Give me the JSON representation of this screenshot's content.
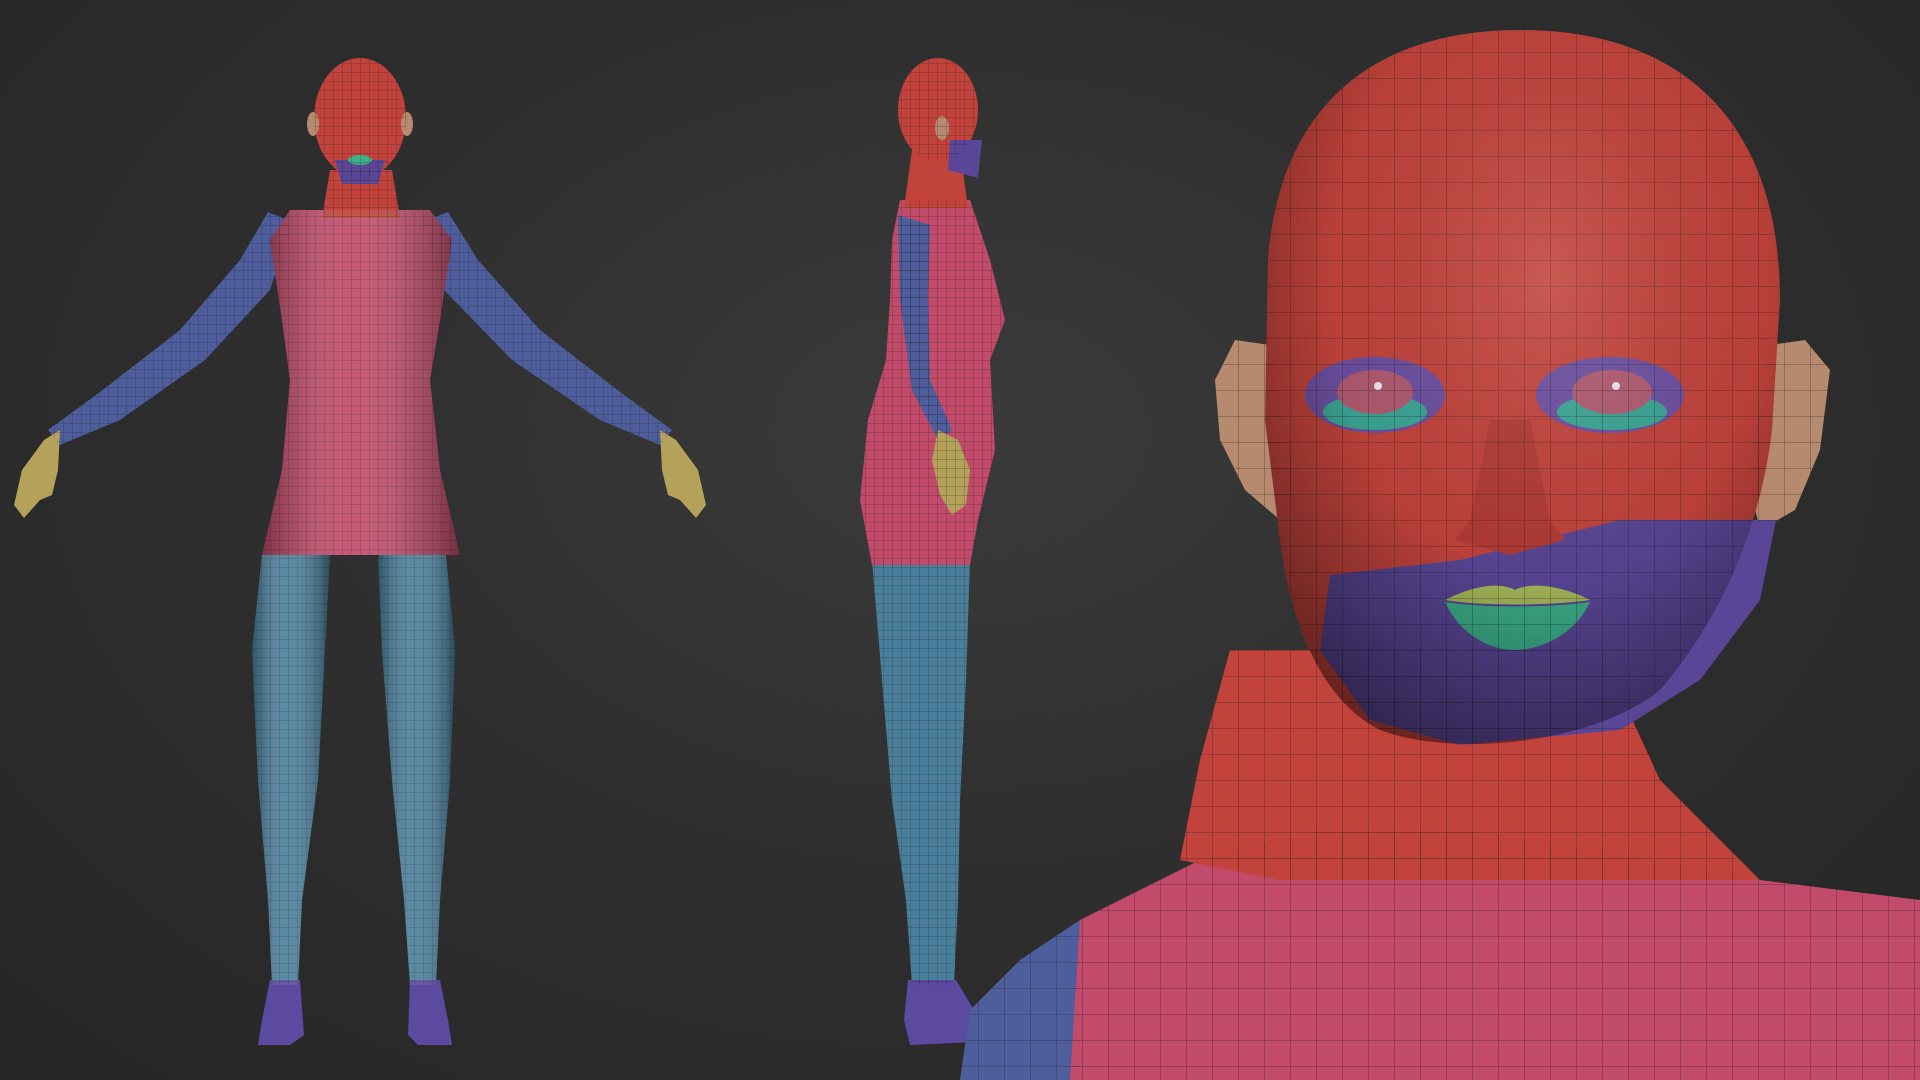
{
  "canvas": {
    "background": "#2e2e2e"
  },
  "palette": {
    "head": "#c2433c",
    "torso": "#c24a6a",
    "arm": "#4e5e9c",
    "leg": "#4a7f9c",
    "foot": "#5b4aa0",
    "hand": "#b5a25a",
    "chin": "#5a4696",
    "lips_lower": "#3cae8a",
    "lips_upper": "#a7b85a",
    "ear": "#b58a6e",
    "eye_ring": "#6c4fa0",
    "eye_lower": "#3ba594",
    "wire": "#1a1a1a"
  },
  "views": [
    {
      "name": "front-view"
    },
    {
      "name": "side-view"
    },
    {
      "name": "head-closeup-view"
    }
  ]
}
